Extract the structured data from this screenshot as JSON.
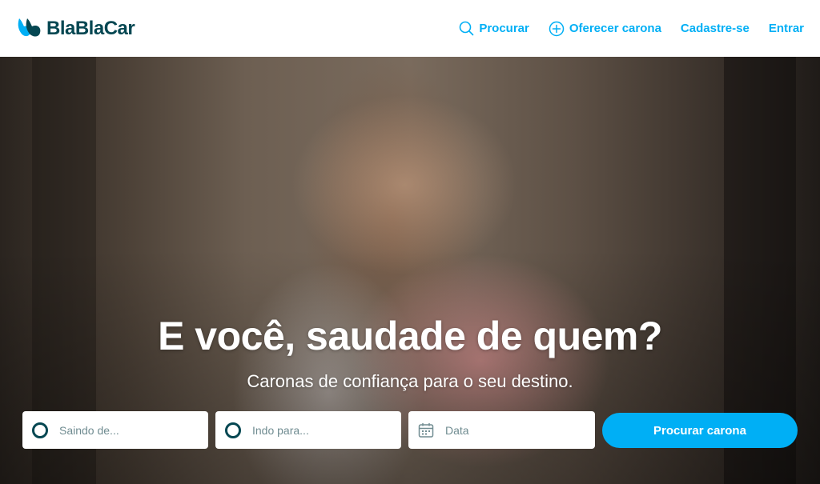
{
  "brand": {
    "name": "BlaBlaCar",
    "logo_icon": "blablacar-logo-icon",
    "colors": {
      "primary": "#00AFF5",
      "dark": "#054752",
      "placeholder": "#708C91"
    }
  },
  "nav": {
    "search": {
      "label": "Procurar",
      "icon": "search-icon"
    },
    "offer": {
      "label": "Oferecer carona",
      "icon": "plus-circle-icon"
    },
    "signup": {
      "label": "Cadastre-se"
    },
    "login": {
      "label": "Entrar"
    }
  },
  "hero": {
    "title": "E você, saudade de quem?",
    "subtitle": "Caronas de confiança para o seu destino."
  },
  "search": {
    "from": {
      "placeholder": "Saindo de...",
      "icon": "circle-icon"
    },
    "to": {
      "placeholder": "Indo para...",
      "icon": "circle-icon"
    },
    "date": {
      "placeholder": "Data",
      "icon": "calendar-icon"
    },
    "button_label": "Procurar carona"
  }
}
